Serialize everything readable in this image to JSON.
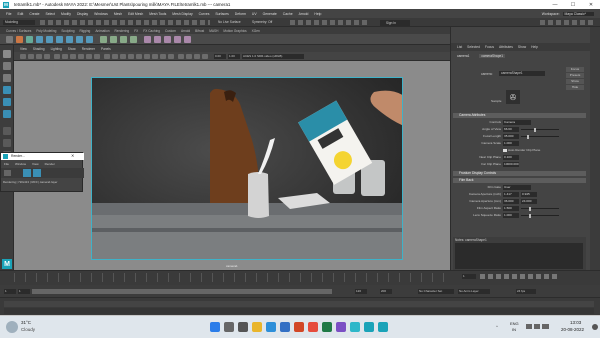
{
  "window": {
    "title": "tetramlk1.mb* - Autodesk MAYA 2022: E:\\Mesmer\\Ust Plants\\pouring milk\\MAYA FILE\\tetramlk1.mb  ---  camera1",
    "minimize": "—",
    "maximize": "☐",
    "close": "✕"
  },
  "menu": [
    "File",
    "Edit",
    "Create",
    "Select",
    "Modify",
    "Display",
    "Windows",
    "Mesh",
    "Edit Mesh",
    "Mesh Tools",
    "Mesh Display",
    "Curves",
    "Surfaces",
    "Deform",
    "UV",
    "Generate",
    "Cache",
    "Arnold",
    "Help"
  ],
  "status": {
    "mode": "Modeling",
    "no_live": "No Live Surface",
    "symmetry": "Symmetry: Off",
    "sign_in": "Sign In",
    "workspace_label": "Workspace:",
    "workspace": "Maya Classic*"
  },
  "shelf_tabs": [
    "Curves / Surfaces",
    "Poly Modeling",
    "Sculpting",
    "Rigging",
    "Animation",
    "Rendering",
    "FX",
    "FX Caching",
    "Custom",
    "Arnold",
    "Bifrost",
    "MASH",
    "Motion Graphics",
    "XGen"
  ],
  "viewport_menu": [
    "View",
    "Shading",
    "Lighting",
    "Show",
    "Renderer",
    "Panels"
  ],
  "viewport": {
    "gamma": "0.00",
    "exposure": "1.00",
    "color_space": "ACES 1.0 SDR-video (sRGB)",
    "camera_name": "camera1",
    "resolution": "1920 x 1080"
  },
  "attr_editor": {
    "tabs": [
      "List",
      "Selected",
      "Focus",
      "Attributes",
      "Show",
      "Help"
    ],
    "node_tabs": [
      "camera1",
      "cameraShape1"
    ],
    "camera_label": "camera:",
    "camera_value": "cameraShape1",
    "focus": "Focus",
    "presets": "Presets",
    "show": "Show",
    "hide": "Hide",
    "sample_label": "Sample",
    "sections": {
      "cam_attr": "Camera Attributes",
      "frustum": "Frustum Display Controls",
      "film_back": "Film Back",
      "notes": "Notes: cameraShape1"
    },
    "controls_label": "Controls",
    "controls_value": "Camera",
    "rows": [
      {
        "label": "Angle of View",
        "value": "66.60"
      },
      {
        "label": "Focal Length",
        "value": "35.000"
      },
      {
        "label": "Camera Scale",
        "value": "1.000"
      },
      {
        "label": "Auto Render Clip Plane",
        "value": ""
      },
      {
        "label": "Near Clip Plane",
        "value": "0.100"
      },
      {
        "label": "Far Clip Plane",
        "value": "10000.000"
      }
    ],
    "film": [
      {
        "label": "Film Gate",
        "v1": "User",
        "v2": ""
      },
      {
        "label": "Camera Aperture (inch)",
        "v1": "1.417",
        "v2": "0.945"
      },
      {
        "label": "Camera Aperture (mm)",
        "v1": "36.000",
        "v2": "24.000"
      },
      {
        "label": "Film Aspect Ratio",
        "v1": "1.500",
        "v2": ""
      },
      {
        "label": "Lens Squeeze Ratio",
        "v1": "1.000",
        "v2": ""
      }
    ],
    "buttons": [
      "Select",
      "Load Attributes",
      "Copy Tab"
    ]
  },
  "popup": {
    "title": "Render...",
    "menu": [
      "File",
      "Window",
      "View",
      "Render"
    ],
    "status": "Rendering | 720x413 | 0/0/0 | camera1:layer"
  },
  "timeline": {
    "start": "1",
    "end": "120",
    "range_start": "1",
    "range_end": "120",
    "range_end2": "200",
    "fps": "24 fps",
    "character": "No Character Set",
    "anim_layer": "No Anim Layer"
  },
  "taskbar": {
    "weather_temp": "31°C",
    "weather_desc": "Cloudy",
    "lang": "ENG",
    "region": "IN",
    "time": "13:03",
    "date": "20-08-2022"
  },
  "colors": {
    "accent": "#3fb2c8",
    "maya_teal": "#1aa3b8",
    "panel": "#444444"
  }
}
